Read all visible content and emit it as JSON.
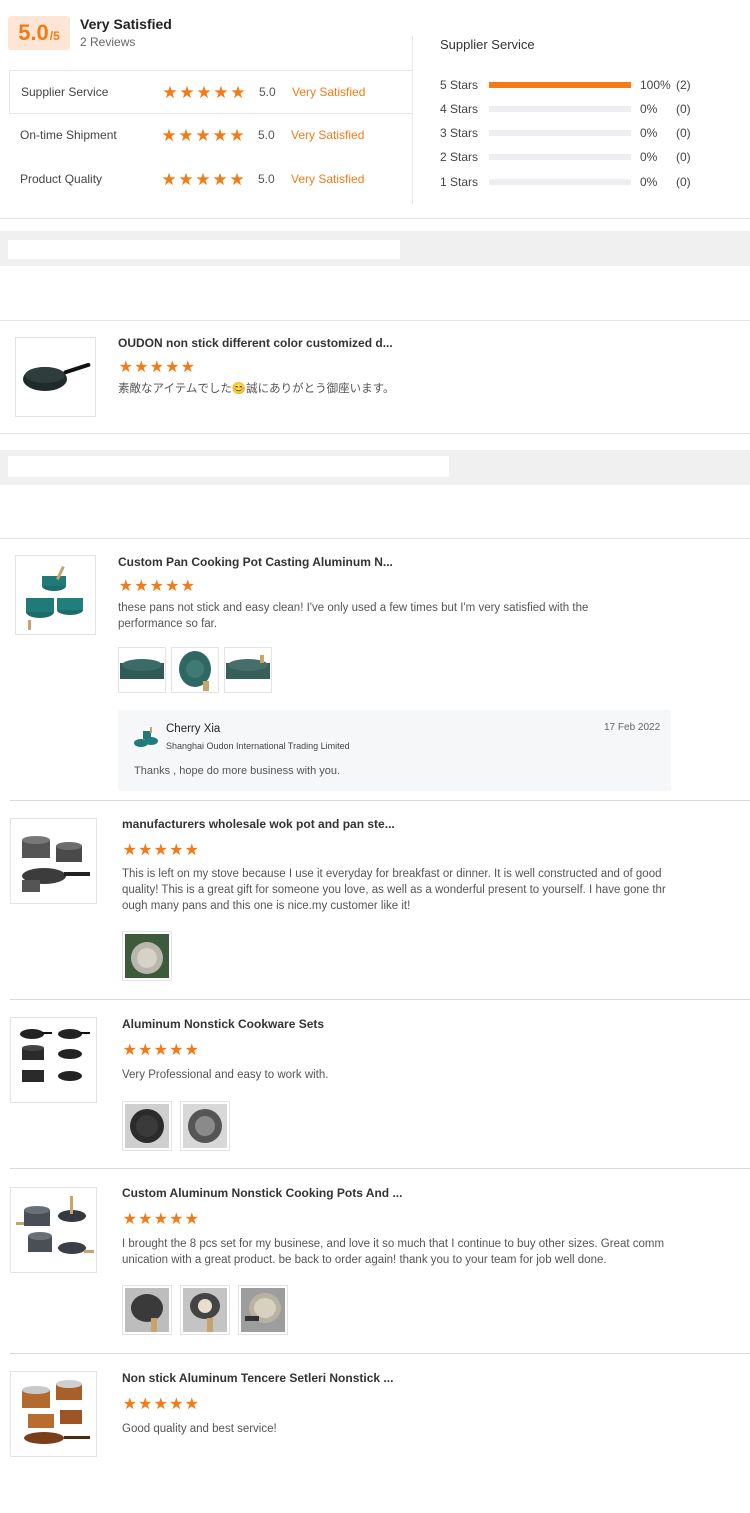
{
  "summary": {
    "score": "5.0",
    "score_max": "/5",
    "title": "Very Satisfied",
    "reviews": "2 Reviews"
  },
  "metrics": [
    {
      "label": "Supplier Service",
      "value": "5.0",
      "status": "Very Satisfied",
      "stars": 5
    },
    {
      "label": "On-time Shipment",
      "value": "5.0",
      "status": "Very Satisfied",
      "stars": 5
    },
    {
      "label": "Product Quality",
      "value": "5.0",
      "status": "Very Satisfied",
      "stars": 5
    }
  ],
  "distribution": {
    "title": "Supplier Service",
    "rows": [
      {
        "label": "5 Stars",
        "pct": "100%",
        "count": "(2)",
        "fill": 1.0
      },
      {
        "label": "4 Stars",
        "pct": "0%",
        "count": "(0)",
        "fill": 0
      },
      {
        "label": "3 Stars",
        "pct": "0%",
        "count": "(0)",
        "fill": 0
      },
      {
        "label": "2 Stars",
        "pct": "0%",
        "count": "(0)",
        "fill": 0
      },
      {
        "label": "1 Stars",
        "pct": "0%",
        "count": "(0)",
        "fill": 0
      }
    ]
  },
  "reviews": [
    {
      "title": "OUDON non stick different color customized d...",
      "text": "素敵なアイテムでした😊誠にありがとう御座います。",
      "stars": 5,
      "icon": "wok-icon"
    },
    {
      "title": "Custom Pan Cooking Pot Casting Aluminum N...",
      "text": "these pans not stick and easy clean! I've only used a few times but I'm very satisfied with the performance so far.",
      "stars": 5,
      "icon": "green-cookware-set-icon",
      "photos": 3
    },
    {
      "title": "manufacturers wholesale wok pot and pan ste...",
      "text": "This is left on my stove because I use it everyday for breakfast or dinner. It is well constructed and of good quality! This is a great gift for someone you love, as well as a wonderful present to yourself. I have gone thr ough many pans and this one is nice.my customer like it!",
      "stars": 5,
      "icon": "gray-cookware-set-icon",
      "photos": 1
    },
    {
      "title": "Aluminum Nonstick Cookware Sets",
      "text": "Very Professional and easy to work with.",
      "stars": 5,
      "icon": "black-cookware-set-icon",
      "photos": 2
    },
    {
      "title": "Custom Aluminum Nonstick Cooking Pots And ...",
      "text": "I brought the 8 pcs set for my businese, and love it so much that I continue to buy other sizes.  Great comm unication with a great product. be back to order again! thank you to your team for job well done.",
      "stars": 5,
      "icon": "wood-handle-cookware-icon",
      "photos": 3
    },
    {
      "title": "Non stick Aluminum Tencere Setleri Nonstick ...",
      "text": "Good quality and best service!",
      "stars": 5,
      "icon": "copper-cookware-set-icon"
    }
  ],
  "reply": {
    "name": "Cherry Xia",
    "company": "Shanghai Oudon International Trading Limited",
    "date": "17 Feb 2022",
    "text": "Thanks , hope do more business with you."
  },
  "colors": {
    "accent": "#f47a16",
    "badge_bg": "#fde6d6",
    "band": "#f0f0f0"
  }
}
